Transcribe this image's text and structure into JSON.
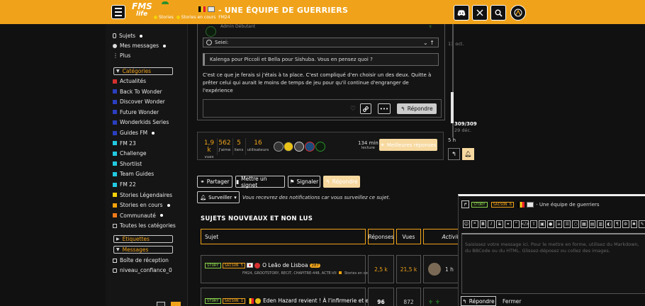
{
  "header": {
    "logo_main": "FMS",
    "logo_sub": "life",
    "title": "- UNE ÉQUIPE DE GUERRIERS",
    "crumbs": [
      "Stories",
      "Stories en cours",
      "FM24"
    ],
    "icons": [
      "discord-icon",
      "x-icon",
      "search-icon",
      "avatar-icon"
    ],
    "accent": "#f0a31a"
  },
  "sidebar": {
    "top": [
      {
        "label": "Sujets"
      },
      {
        "label": "Mes messages"
      },
      {
        "label": "Plus"
      }
    ],
    "sections": {
      "categories": "Catégories",
      "etiquettes": "Étiquettes",
      "messages": "Messages"
    },
    "categories": [
      {
        "label": "Actualités",
        "color": "#d43030"
      },
      {
        "label": "Back To Wonder",
        "color": "#2c3fbf"
      },
      {
        "label": "Discover Wonder",
        "color": "#2c3fbf"
      },
      {
        "label": "Future Wonder",
        "color": "#2c3fbf"
      },
      {
        "label": "Wonderkids Series",
        "color": "#2c3fbf"
      },
      {
        "label": "Guides FM",
        "color": "#2c3fbf"
      },
      {
        "label": "FM 23",
        "color": "#22c9e0"
      },
      {
        "label": "Challenge",
        "color": "#22c9e0"
      },
      {
        "label": "Shortlist",
        "color": "#22c9e0"
      },
      {
        "label": "Team Guides",
        "color": "#22c9e0"
      },
      {
        "label": "FM 22",
        "color": "#22c9e0"
      },
      {
        "label": "Stories Légendaires",
        "color": "#f5d10a"
      },
      {
        "label": "Stories en cours",
        "color": "#f5a30a"
      },
      {
        "label": "Communauté",
        "color": "#f07a1a"
      },
      {
        "label": "Toutes les catégories",
        "color": "#cccccc"
      }
    ],
    "messages": [
      {
        "label": "Boîte de réception"
      },
      {
        "label": "niveau_confiance_0"
      }
    ]
  },
  "post": {
    "author_note": "Admin Débutant",
    "quote_author": "Seiei:",
    "quote_text": "Kalenga pour Piccoli et Bella pour Sishuba. Vous en pensez quoi ?",
    "body": "C'est ce que je ferais si j'étais à ta place. C'est compliqué d'en choisir un des deux. Quitte à prêter celui qui aurait le moins de temps de jeu pour qu'il continue d'engranger de l'expérience",
    "reply_label": "Répondre"
  },
  "timeline": {
    "top_date": "13 oct.",
    "count": "309/309",
    "date": "29 déc.",
    "ago": "5 h"
  },
  "stats": {
    "vues": {
      "num": "1,9 k",
      "lbl": "vues"
    },
    "jaime": {
      "num": "562",
      "lbl": "J'aime"
    },
    "liens": {
      "num": "5",
      "lbl": "liens"
    },
    "users": {
      "num": "16",
      "lbl": "utilisateurs"
    },
    "lecture": {
      "num": "134 min",
      "lbl": "lecture"
    },
    "best": "Meilleures réponses"
  },
  "actions": {
    "partager": "Partager",
    "signet": "Mettre un signet",
    "signaler": "Signaler",
    "repondre": "Répondre",
    "surveiller": "Surveiller",
    "note": "Vous recevrez des notifications car vous surveillez ce sujet."
  },
  "topics": {
    "title": "SUJETS NOUVEAUX ET NON LUS",
    "headers": {
      "sujet": "Sujet",
      "reponses": "Réponses",
      "vues": "Vues",
      "activite": "Activité"
    },
    "rows": [
      {
        "tags": [
          "STORY",
          "SAISON 5"
        ],
        "title": "O Leão de Lisboa",
        "badge": "287",
        "meta": "FM24, GROOTSTORY, RECIT, CHAPITRE-448, ACTE-VII",
        "category": "Stories en cours",
        "replies": "2,5 k",
        "views": "21,5 k",
        "activity": "1 h"
      },
      {
        "tags": [
          "STORY",
          "SAISON 1"
        ],
        "title": "Eden Hazard revient ! À l'infirmerie et en",
        "replies": "96",
        "views": "872"
      }
    ]
  },
  "composer": {
    "tags": [
      "STORY",
      "SAISON 6"
    ],
    "title": "- Une équipe de guerriers",
    "placeholder": "Saisissez votre message ici. Pour le mettre en forme, utilisez du Markdown, du BBCode ou du HTML. Glissez-déposez ou collez des images.",
    "reply": "Répondre",
    "close": "Fermer"
  }
}
